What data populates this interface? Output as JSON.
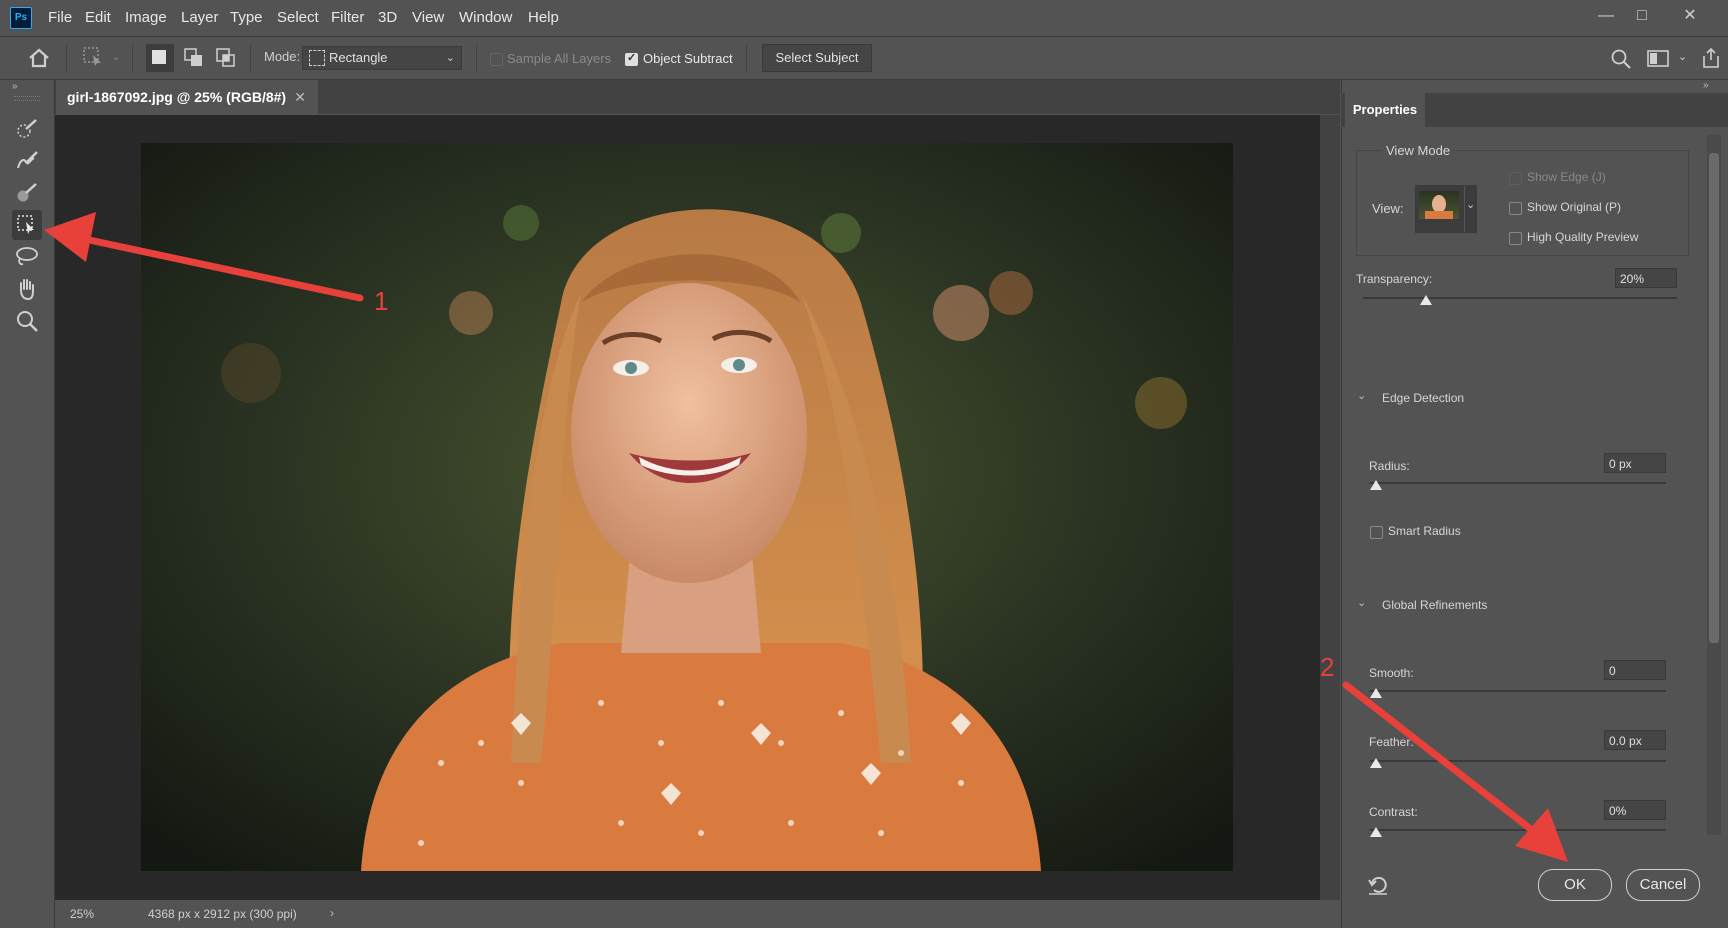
{
  "app": {
    "logo": "Ps",
    "menu": [
      "File",
      "Edit",
      "Image",
      "Layer",
      "Type",
      "Select",
      "Filter",
      "3D",
      "View",
      "Window",
      "Help"
    ]
  },
  "options": {
    "mode_label": "Mode:",
    "mode_value": "Rectangle",
    "sample_all_layers": "Sample All Layers",
    "object_subtract": "Object Subtract",
    "select_subject": "Select Subject"
  },
  "document": {
    "tab_title": "girl-1867092.jpg @ 25% (RGB/8#)",
    "zoom": "25%",
    "info": "4368 px x 2912 px (300 ppi)"
  },
  "panel": {
    "title": "Properties",
    "view_mode": "View Mode",
    "view_label": "View:",
    "show_edge": "Show Edge (J)",
    "show_original": "Show Original (P)",
    "high_quality_preview": "High Quality Preview",
    "transparency_label": "Transparency:",
    "transparency_value": "20%",
    "edge_detection": "Edge Detection",
    "radius_label": "Radius:",
    "radius_value": "0 px",
    "smart_radius": "Smart Radius",
    "global_refinements": "Global Refinements",
    "smooth_label": "Smooth:",
    "smooth_value": "0",
    "feather_label": "Feather:",
    "feather_value": "0.0 px",
    "contrast_label": "Contrast:",
    "contrast_value": "0%",
    "ok": "OK",
    "cancel": "Cancel"
  },
  "annotations": {
    "arrow1_label": "1",
    "arrow2_label": "2",
    "arrow_color": "#e8403a"
  }
}
